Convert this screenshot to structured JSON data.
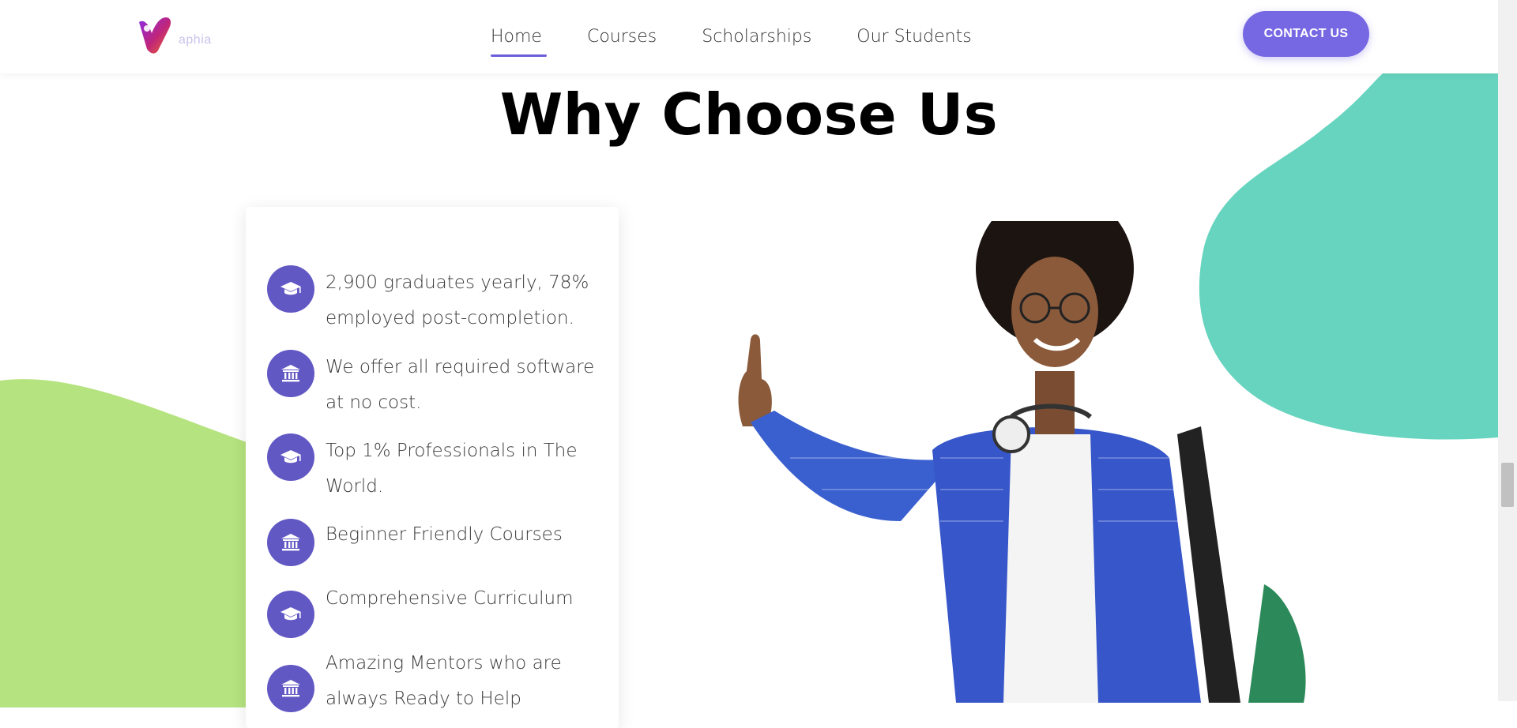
{
  "header": {
    "logo_text": "aphia",
    "nav": [
      {
        "label": "Home",
        "active": true
      },
      {
        "label": "Courses",
        "active": false
      },
      {
        "label": "Scholarships",
        "active": false
      },
      {
        "label": "Our Students",
        "active": false
      }
    ],
    "contact_label": "CONTACT US"
  },
  "section": {
    "title": "Why Choose Us"
  },
  "features": [
    {
      "icon": "graduation-cap-icon",
      "line1": "2,900 graduates yearly, 78%",
      "line2": "employed post-completion."
    },
    {
      "icon": "institution-icon",
      "line1": "We offer all required software",
      "line2": "at no cost."
    },
    {
      "icon": "graduation-cap-icon",
      "line1": "Top 1% Professionals in The",
      "line2": "World."
    },
    {
      "icon": "institution-icon",
      "line1": "Beginner Friendly Courses",
      "line2": ""
    },
    {
      "icon": "graduation-cap-icon",
      "line1": "Comprehensive Curriculum",
      "line2": ""
    },
    {
      "icon": "institution-icon",
      "line1": "Amazing Mentors who are",
      "line2": "always Ready to Help"
    }
  ],
  "colors": {
    "accent": "#7667e3",
    "icon_bg": "#6258c4",
    "blob_green": "#b5e37f",
    "blob_teal": "#67d4bf"
  }
}
